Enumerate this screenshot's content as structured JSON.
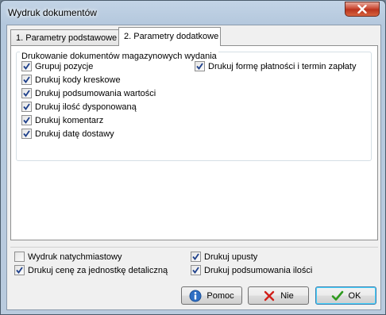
{
  "window": {
    "title": "Wydruk dokumentów"
  },
  "tabs": [
    {
      "label": "1. Parametry podstawowe",
      "selected": false
    },
    {
      "label": "2. Parametry dodatkowe",
      "selected": true
    }
  ],
  "group": {
    "label": "Drukowanie dokumentów magazynowych wydania",
    "left_options": [
      {
        "label": "Grupuj pozycje",
        "checked": true
      },
      {
        "label": "Drukuj kody kreskowe",
        "checked": true
      },
      {
        "label": "Drukuj podsumowania wartości",
        "checked": true
      },
      {
        "label": "Drukuj ilość dysponowaną",
        "checked": true
      },
      {
        "label": "Drukuj komentarz",
        "checked": true
      },
      {
        "label": "Drukuj datę dostawy",
        "checked": true
      }
    ],
    "right_options": [
      {
        "label": "Drukuj formę płatności i termin zapłaty",
        "checked": true
      }
    ]
  },
  "bottom_options": [
    {
      "label": "Wydruk natychmiastowy",
      "checked": false
    },
    {
      "label": "Drukuj upusty",
      "checked": true
    },
    {
      "label": "Drukuj cenę za jednostkę detaliczną",
      "checked": true
    },
    {
      "label": "Drukuj podsumowania ilości",
      "checked": true
    }
  ],
  "buttons": {
    "help": "Pomoc",
    "no": "Nie",
    "ok": "OK"
  },
  "colors": {
    "accent": "#3c7fb1",
    "close": "#c7402a",
    "check": "#1d3f8a"
  }
}
